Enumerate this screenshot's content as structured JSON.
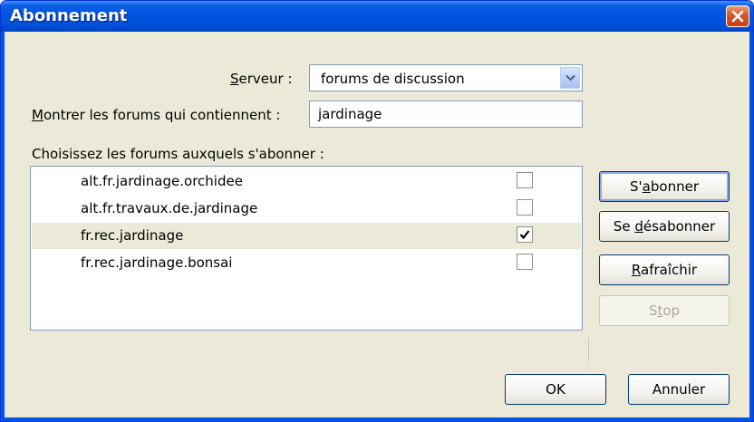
{
  "window": {
    "title": "Abonnement"
  },
  "server": {
    "label": "Serveur :",
    "value": "forums de discussion"
  },
  "filter": {
    "label": "Montrer les forums qui contiennent :",
    "value": "jardinage"
  },
  "list": {
    "label": "Choisissez les forums auxquels s'abonner :",
    "items": [
      {
        "name": "alt.fr.jardinage.orchidee",
        "checked": false
      },
      {
        "name": "alt.fr.travaux.de.jardinage",
        "checked": false
      },
      {
        "name": "fr.rec.jardinage",
        "checked": true
      },
      {
        "name": "fr.rec.jardinage.bonsai",
        "checked": false
      }
    ]
  },
  "buttons": {
    "subscribe": "S'abonner",
    "unsubscribe": "Se désabonner",
    "refresh": "Rafraîchir",
    "stop": "Stop",
    "ok": "OK",
    "cancel": "Annuler"
  },
  "icons": {
    "close": "close-icon",
    "dropdown": "chevron-down-icon",
    "check": "checkmark-icon"
  },
  "colors": {
    "titlebar": "#0054e3",
    "close": "#c63d14",
    "dialog_bg": "#ece9d8"
  }
}
